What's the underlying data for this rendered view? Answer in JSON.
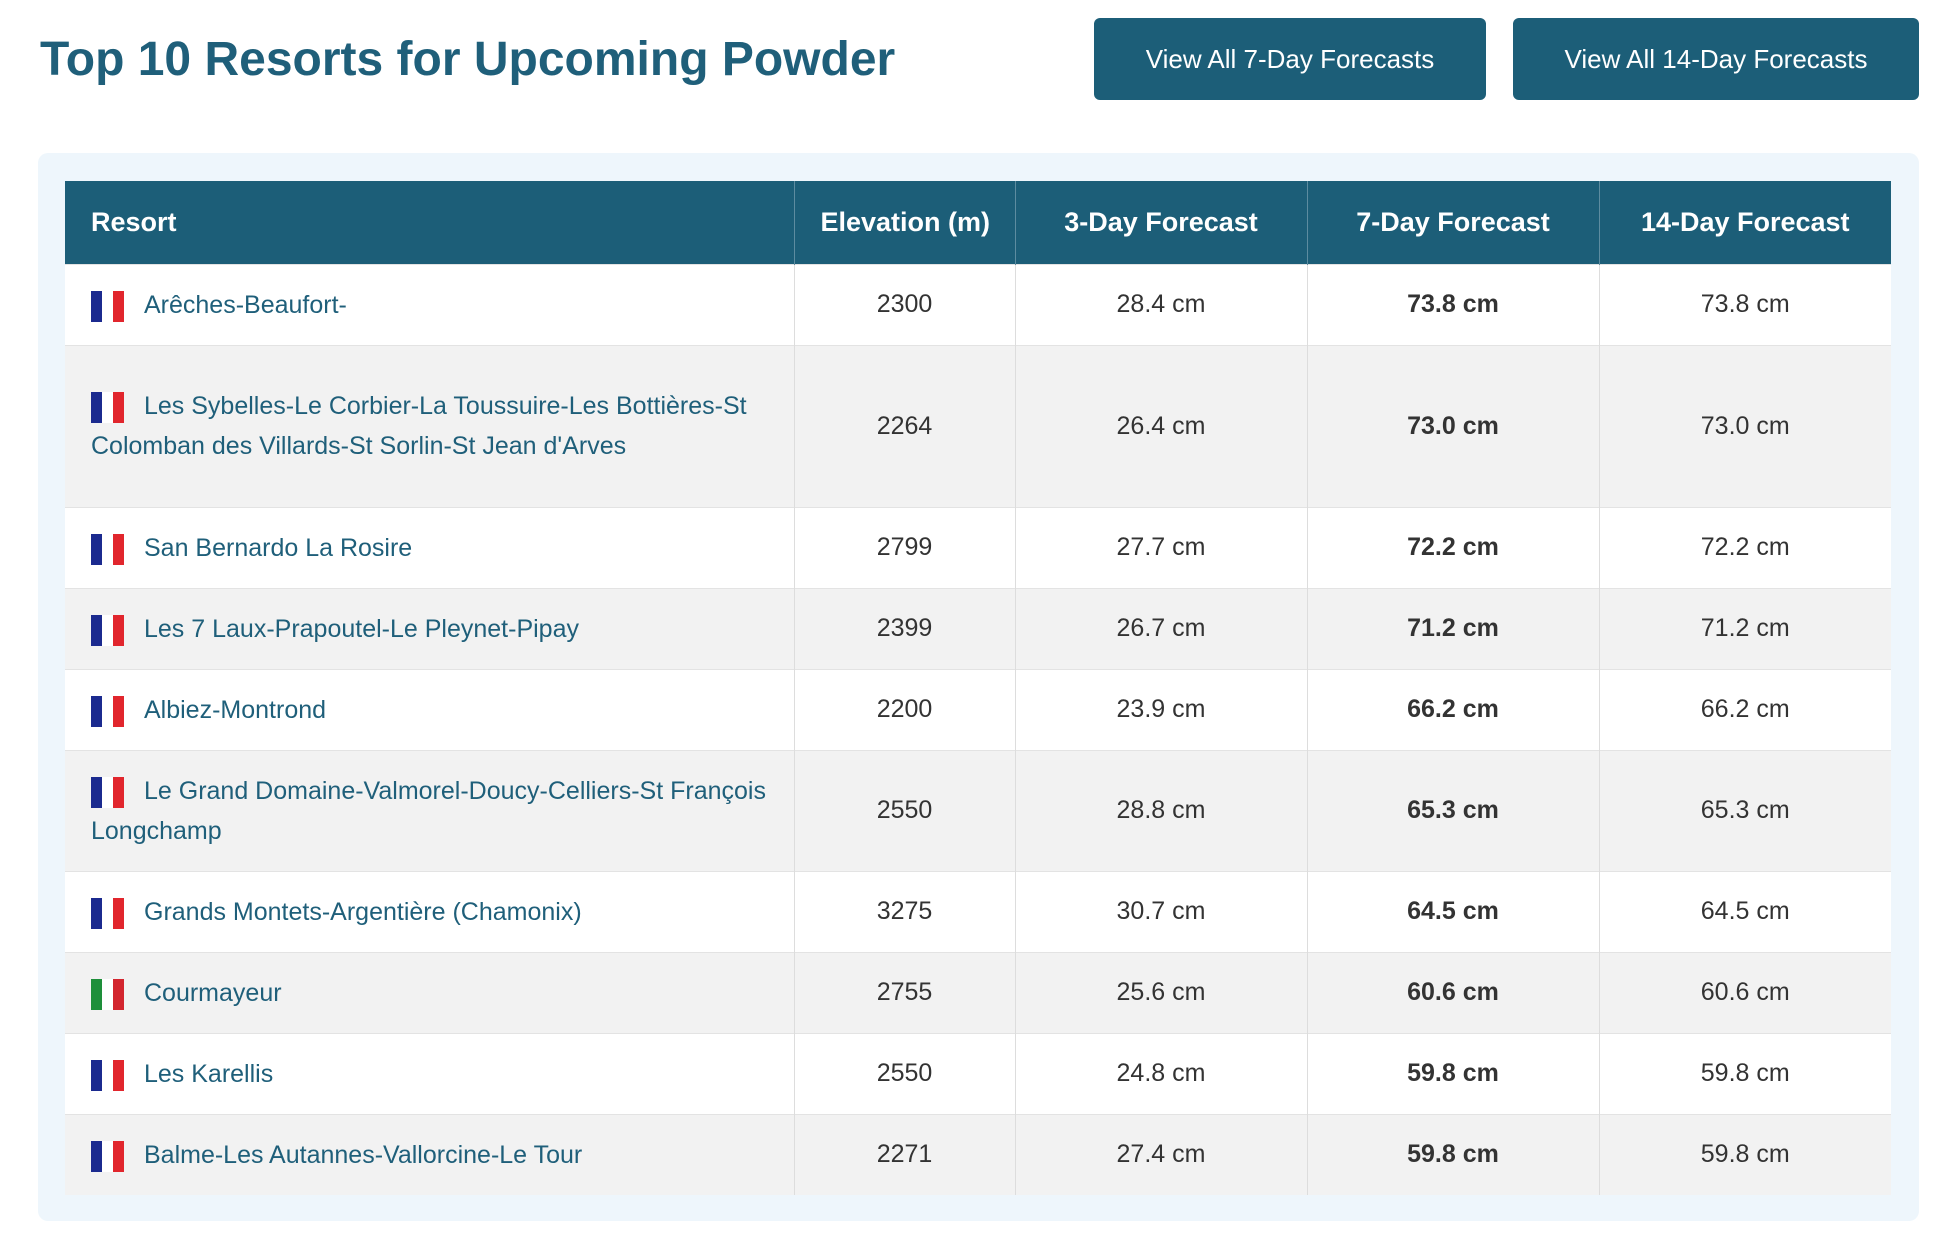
{
  "page": {
    "title": "Top 10 Resorts for Upcoming Powder",
    "btn_7day": "View All 7-Day Forecasts",
    "btn_14day": "View All 14-Day Forecasts"
  },
  "colors": {
    "primary": "#1c5e78",
    "accent": "#2f86a8",
    "france": [
      "#1b2a8f",
      "#ffffff",
      "#e1262d"
    ],
    "italy": [
      "#1e8f3a",
      "#ffffff",
      "#d3262f"
    ]
  },
  "table": {
    "headers": [
      "Resort",
      "Elevation (m)",
      "3-Day Forecast",
      "7-Day Forecast",
      "14-Day Forecast"
    ],
    "rows": [
      {
        "flag": "france-flag-icon",
        "name": "Arêches-Beaufort-",
        "elevation": "2300",
        "d3": "28.4 cm",
        "d7": "73.8 cm",
        "d14": "73.8 cm"
      },
      {
        "flag": "france-flag-icon",
        "name": "Les Sybelles-Le Corbier-La Toussuire-Les Bottières-St Colomban des Villards-St Sorlin-St Jean d'Arves",
        "elevation": "2264",
        "d3": "26.4 cm",
        "d7": "73.0 cm",
        "d14": "73.0 cm"
      },
      {
        "flag": "france-flag-icon",
        "name": "San Bernardo La Rosire",
        "elevation": "2799",
        "d3": "27.7 cm",
        "d7": "72.2 cm",
        "d14": "72.2 cm"
      },
      {
        "flag": "france-flag-icon",
        "name": "Les 7 Laux-Prapoutel-Le Pleynet-Pipay",
        "elevation": "2399",
        "d3": "26.7 cm",
        "d7": "71.2 cm",
        "d14": "71.2 cm"
      },
      {
        "flag": "france-flag-icon",
        "name": "Albiez-Montrond",
        "elevation": "2200",
        "d3": "23.9 cm",
        "d7": "66.2 cm",
        "d14": "66.2 cm"
      },
      {
        "flag": "france-flag-icon",
        "name": "Le Grand Domaine-Valmorel-Doucy-Celliers-St François Longchamp",
        "elevation": "2550",
        "d3": "28.8 cm",
        "d7": "65.3 cm",
        "d14": "65.3 cm"
      },
      {
        "flag": "france-flag-icon",
        "name": "Grands Montets-Argentière (Chamonix)",
        "elevation": "3275",
        "d3": "30.7 cm",
        "d7": "64.5 cm",
        "d14": "64.5 cm"
      },
      {
        "flag": "italy-flag-icon",
        "name": "Courmayeur",
        "elevation": "2755",
        "d3": "25.6 cm",
        "d7": "60.6 cm",
        "d14": "60.6 cm"
      },
      {
        "flag": "france-flag-icon",
        "name": "Les Karellis",
        "elevation": "2550",
        "d3": "24.8 cm",
        "d7": "59.8 cm",
        "d14": "59.8 cm"
      },
      {
        "flag": "france-flag-icon",
        "name": "Balme-Les Autannes-Vallorcine-Le Tour",
        "elevation": "2271",
        "d3": "27.4 cm",
        "d7": "59.8 cm",
        "d14": "59.8 cm"
      }
    ]
  }
}
